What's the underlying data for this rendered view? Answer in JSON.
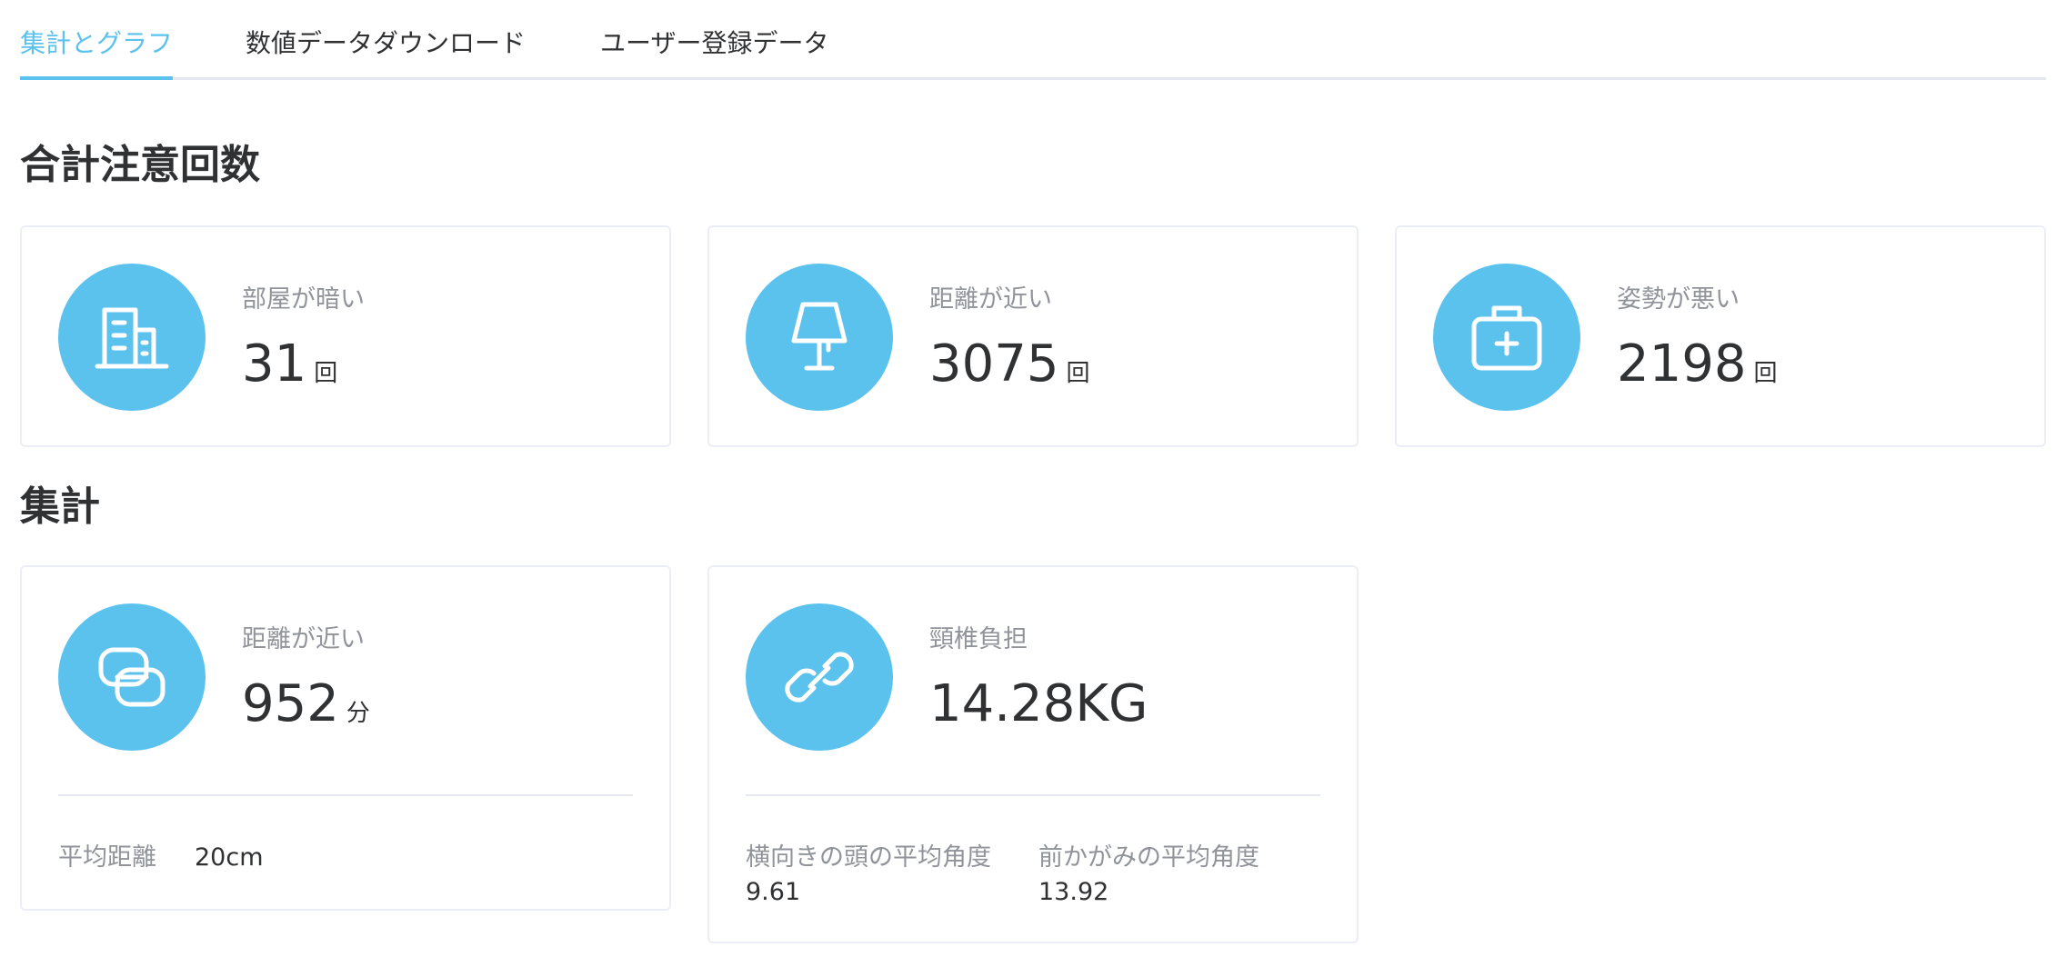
{
  "tabs": [
    {
      "label": "集計とグラフ",
      "active": true
    },
    {
      "label": "数値データダウンロード",
      "active": false
    },
    {
      "label": "ユーザー登録データ",
      "active": false
    }
  ],
  "sections": {
    "warnings_title": "合計注意回数",
    "summary_title": "集計"
  },
  "warnings": [
    {
      "icon": "building-icon",
      "label": "部屋が暗い",
      "value": "31",
      "unit": "回"
    },
    {
      "icon": "lamp-icon",
      "label": "距離が近い",
      "value": "3075",
      "unit": "回"
    },
    {
      "icon": "first-aid-kit-icon",
      "label": "姿勢が悪い",
      "value": "2198",
      "unit": "回"
    }
  ],
  "summary": [
    {
      "icon": "copy-loop-icon",
      "label": "距離が近い",
      "value": "952",
      "unit": "分",
      "footer": [
        {
          "label": "平均距離",
          "value": "20cm"
        }
      ]
    },
    {
      "icon": "link-icon",
      "label": "頸椎負担",
      "value": "14.28KG",
      "unit": "",
      "footer": [
        {
          "label": "横向きの頭の平均角度",
          "value": "9.61"
        },
        {
          "label": "前かがみの平均角度",
          "value": "13.92"
        }
      ]
    }
  ],
  "colors": {
    "accent": "#5bc2ee",
    "border": "#ebeef5",
    "muted_text": "#909399",
    "main_text": "#303133"
  }
}
